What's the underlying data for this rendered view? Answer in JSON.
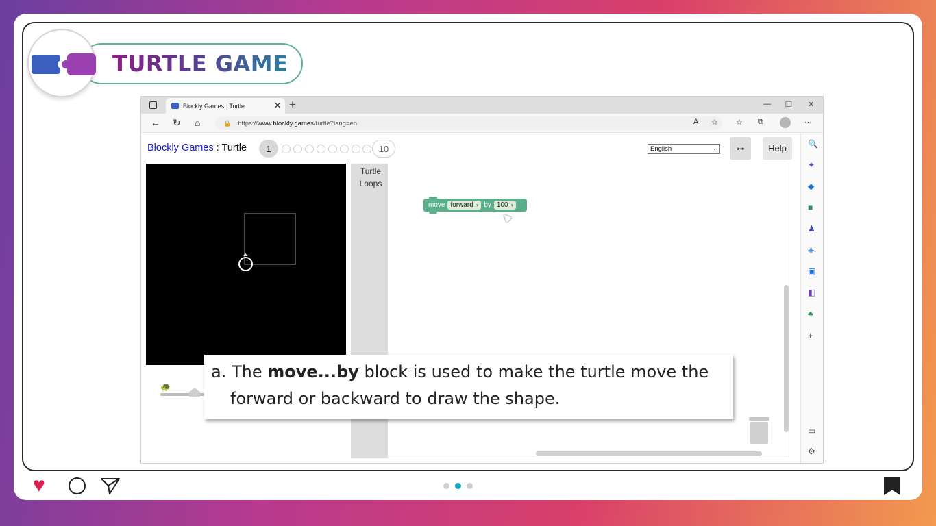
{
  "slide": {
    "title": "TURTLE GAME",
    "caption_prefix": "a. The ",
    "caption_bold": "move...by",
    "caption_line1_rest": " block is used to make the turtle move the",
    "caption_line2": "forward or backward to draw the shape.",
    "colors": {
      "heart": "#d61f4f",
      "dot_active": "#19a7c1",
      "title_border": "#5fb08f"
    }
  },
  "browser": {
    "tab_title": "Blockly Games : Turtle",
    "new_tab": "+",
    "url_prefix": "https://",
    "url_host": "www.blockly.games",
    "url_path": "/turtle?lang=en"
  },
  "page": {
    "brand_link": "Blockly Games",
    "separator": " : ",
    "game_name": "Turtle",
    "current_level": "1",
    "last_level": "10",
    "language": "English",
    "help_label": "Help",
    "toolbox": [
      "Turtle",
      "Loops"
    ],
    "block": {
      "text_move": "move",
      "direction": "forward",
      "text_by": "by",
      "amount": "100"
    }
  },
  "icons": {
    "edge_sidebar": [
      "search-icon",
      "copilot-icon",
      "shopping-icon",
      "tools-icon",
      "games-icon",
      "office-icon",
      "outlook-icon",
      "drop-icon",
      "tree-icon",
      "add-icon",
      "screen-icon",
      "settings-icon"
    ]
  }
}
